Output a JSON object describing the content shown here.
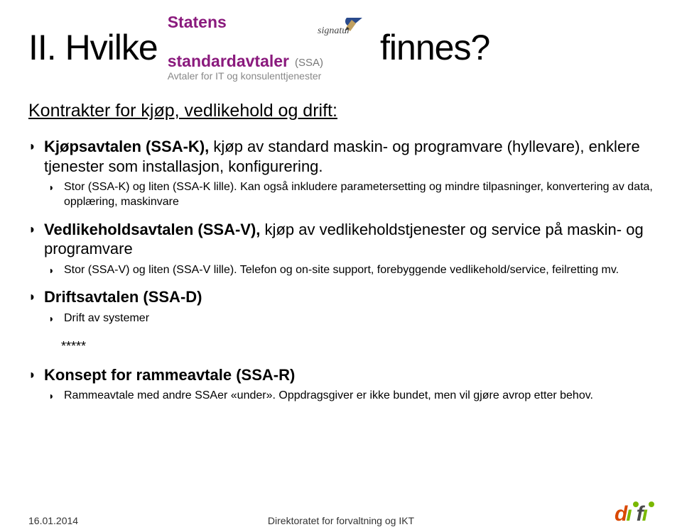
{
  "title": {
    "left": "II. Hvilke",
    "right": "finnes?"
  },
  "logo": {
    "line1": "Statens",
    "line2": "standardavtaler",
    "ssa": "(SSA)",
    "sub": "Avtaler for IT og konsulenttjenester",
    "signature": "signatur"
  },
  "subheading": "Kontrakter for kjøp, vedlikehold og drift:",
  "items": [
    {
      "lead_bold": "Kjøpsavtalen (SSA-K),",
      "lead_rest": " kjøp av standard maskin- og programvare (hyllevare), enklere tjenester som installasjon, konfigurering.",
      "subs": [
        "Stor (SSA-K) og liten (SSA-K lille). Kan også inkludere parametersetting og mindre tilpasninger, konvertering av data, opplæring, maskinvare"
      ]
    },
    {
      "lead_bold": "Vedlikeholdsavtalen (SSA-V),",
      "lead_rest": " kjøp av vedlikeholdstjenester og service på maskin- og programvare",
      "subs": [
        "Stor (SSA-V) og liten (SSA-V lille). Telefon og on-site support, forebyggende vedlikehold/service, feilretting mv."
      ]
    },
    {
      "lead_bold": "Driftsavtalen (SSA-D)",
      "lead_rest": "",
      "subs": [
        "Drift av systemer"
      ]
    }
  ],
  "stars": "*****",
  "items2": [
    {
      "lead_bold": "Konsept for rammeavtale (SSA-R)",
      "lead_rest": "",
      "subs": [
        "Rammeavtale med andre SSAer «under». Oppdragsgiver er ikke bundet, men vil gjøre avrop etter behov."
      ]
    }
  ],
  "footer": {
    "date": "16.01.2014",
    "center": "Direktoratet for forvaltning og IKT"
  }
}
